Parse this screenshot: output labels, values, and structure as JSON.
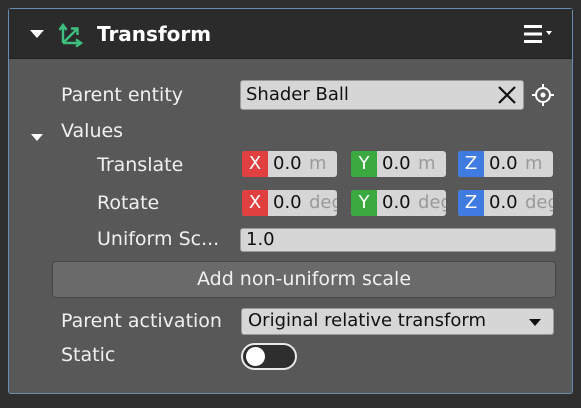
{
  "header": {
    "title": "Transform",
    "icon": "transform-axes-icon",
    "menu_icon": "hamburger-menu-icon"
  },
  "parent_entity": {
    "label": "Parent entity",
    "value": "Shader Ball"
  },
  "values_section": {
    "label": "Values"
  },
  "translate": {
    "label": "Translate",
    "x": {
      "axis": "X",
      "value": "0.0",
      "unit": "m"
    },
    "y": {
      "axis": "Y",
      "value": "0.0",
      "unit": "m"
    },
    "z": {
      "axis": "Z",
      "value": "0.0",
      "unit": "m"
    }
  },
  "rotate": {
    "label": "Rotate",
    "x": {
      "axis": "X",
      "value": "0.0",
      "unit": "deg"
    },
    "y": {
      "axis": "Y",
      "value": "0.0",
      "unit": "deg"
    },
    "z": {
      "axis": "Z",
      "value": "0.0",
      "unit": "deg"
    }
  },
  "uniform_scale": {
    "label": "Uniform Sc...",
    "value": "1.0"
  },
  "add_scale_button": {
    "label": "Add non-uniform scale"
  },
  "parent_activation": {
    "label": "Parent activation",
    "selected": "Original relative transform"
  },
  "static": {
    "label": "Static",
    "enabled": false
  },
  "colors": {
    "x_axis": "#e04040",
    "y_axis": "#39a940",
    "z_axis": "#3f7be0",
    "accent_border": "#6a8bb0",
    "icon_green": "#3fbf7f"
  }
}
